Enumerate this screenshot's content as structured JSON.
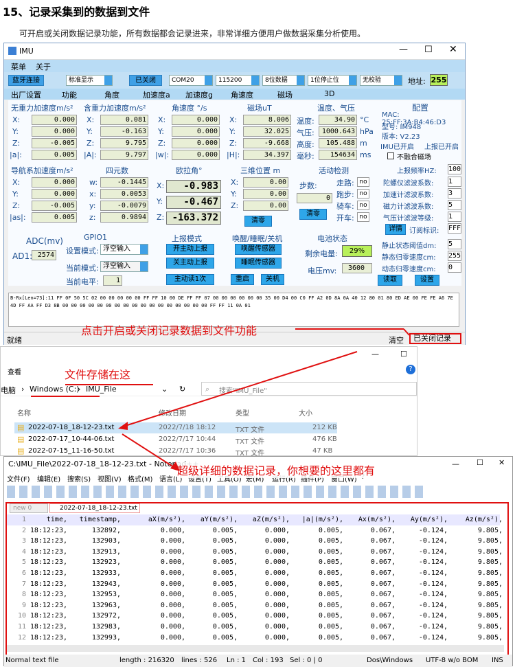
{
  "heading": "15、记录采集到的数据到文件",
  "intro": "可开启或关闭数据记录功能，所有数据都会记录进来，非常详细方便用户做数据采集分析使用。",
  "imu": {
    "title": "IMU",
    "menu": [
      "菜单",
      "关于"
    ],
    "toolbar": {
      "bt": "蓝牙连接",
      "display": "标准显示",
      "closed": "已关闭",
      "port": "COM20",
      "baud": "115200",
      "bits": "8位数据",
      "stop": "1位停止位",
      "parity": "无校验",
      "addr_label": "地址:",
      "addr": "255"
    },
    "tabs": [
      "出厂设置",
      "功能",
      "角度",
      "加速度a",
      "加速度g",
      "角速度",
      "磁场",
      "3D"
    ],
    "acc_nog": {
      "title": "无重力加速度m/s²",
      "labels": [
        "X:",
        "Y:",
        "Z:",
        "|a|:"
      ],
      "values": [
        "0.000",
        "0.000",
        "-0.005",
        "0.005"
      ]
    },
    "acc_g": {
      "title": "含重力加速度m/s²",
      "labels": [
        "X:",
        "Y:",
        "Z:",
        "|A|:"
      ],
      "values": [
        "0.081",
        "-0.163",
        "9.795",
        "9.797"
      ]
    },
    "gyro": {
      "title": "角速度 °/s",
      "labels": [
        "X:",
        "Y:",
        "Z:",
        "|w|:"
      ],
      "values": [
        "0.000",
        "0.000",
        "0.000",
        "0.000"
      ]
    },
    "mag": {
      "title": "磁场uT",
      "labels": [
        "X:",
        "Y:",
        "Z:",
        "|H|:"
      ],
      "values": [
        "8.006",
        "32.025",
        "-9.668",
        "34.397"
      ]
    },
    "env": {
      "title": "温度、气压",
      "labels": [
        "温度:",
        "气压:",
        "高度:",
        "毫秒:"
      ],
      "values": [
        "34.90",
        "1000.643",
        "105.488",
        "154634"
      ],
      "units": [
        "°C",
        "hPa",
        "m",
        "ms"
      ]
    },
    "config": {
      "title": "配置",
      "mac": "MAC: 25:FF:3A:B4:46:D3",
      "model": "型号: IM948",
      "version": "版本: V2.23",
      "state1": "IMU已开启",
      "state2": "上报已开启",
      "nomag": "不融合磁场",
      "items": [
        [
          "上报频率HZ:",
          "100"
        ],
        [
          "陀螺仪滤波系数:",
          "1"
        ],
        [
          "加速计滤波系数:",
          "3"
        ],
        [
          "磁力计滤波系数:",
          "5"
        ],
        [
          "气压计滤波等级:",
          "1"
        ]
      ],
      "detail": "详情",
      "sub": "订阅标识:",
      "sub_val": "FFF",
      "items2": [
        [
          "静止状态阈值dm:",
          "5"
        ],
        [
          "静态归零速度cm:",
          "255"
        ],
        [
          "动态归零速度cm:",
          "0"
        ]
      ],
      "read": "读取",
      "set": "设置"
    },
    "nav": {
      "title": "导航系加速度m/s²",
      "labels": [
        "X:",
        "Y:",
        "Z:",
        "|as|:"
      ],
      "values": [
        "0.000",
        "0.000",
        "-0.005",
        "0.005"
      ]
    },
    "quat": {
      "title": "四元数",
      "labels": [
        "w:",
        "x:",
        "y:",
        "z:"
      ],
      "values": [
        "-0.1445",
        "0.0053",
        "-0.0079",
        "0.9894"
      ]
    },
    "euler": {
      "title": "欧拉角°",
      "labels": [
        "X:",
        "Y:",
        "Z:"
      ],
      "values": [
        "-0.983",
        "-0.467",
        "-163.372"
      ]
    },
    "pos": {
      "title": "三维位置 m",
      "labels": [
        "X:",
        "Y:",
        "Z:"
      ],
      "values": [
        "0.00",
        "0.00",
        "0.00"
      ],
      "clear": "清零"
    },
    "activity": {
      "title": "活动检测",
      "steps": "步数:",
      "steps_val": "0",
      "clear": "清零",
      "items": [
        [
          "走路:",
          "no"
        ],
        [
          "跑步:",
          "no"
        ],
        [
          "骑车:",
          "no"
        ],
        [
          "开车:",
          "no"
        ]
      ]
    },
    "adc": {
      "title": "ADC(mv)",
      "label": "AD1:",
      "value": "2574"
    },
    "gpio": {
      "title": "GPIO1",
      "mode_label": "设置模式:",
      "mode": "浮空输入",
      "cur_label": "当前模式:",
      "cur": "浮空输入",
      "level_label": "当前电平:",
      "level": "1"
    },
    "report": {
      "title": "上报模式",
      "b1": "开主动上报",
      "b2": "关主动上报",
      "b3": "主动读1次"
    },
    "wake": {
      "title": "唤醒/睡眠/关机",
      "b1": "唤醒传感器",
      "b2": "睡眠传感器",
      "b3": "重启",
      "b4": "关机"
    },
    "battery": {
      "title": "电池状态",
      "rem_label": "剩余电量:",
      "rem": "29%",
      "v_label": "电压mv:",
      "v": "3600"
    },
    "raw": "B-Rx[Len=73]:11 FF 0F 50 5C 02 00 00 00 00 00 FF FF 10 00 DE FF FF 07 00 00 00 00 00 00 35 00 D4 00 C0 FF A2 0D 8A 0A 40 12 80 01 80 ED AE 00 FE FE A6 7E 4D FF AA FF D3 8B 00 00 00 00 00 00 00 00 00 00 00 00 00 00 00 00 00 FF FF 11 0A 01",
    "status_left": "就绪",
    "clear": "清空",
    "log": "已关闭记录"
  },
  "callouts": {
    "c1": "点击开启或关闭记录数据到文件功能",
    "c2": "文件存储在这",
    "c3": "超级详细的数据记录，你想要的这里都有"
  },
  "explorer": {
    "view": "查看",
    "path": [
      "电脑",
      "Windows (C:)",
      "IMU_File"
    ],
    "search": "搜索\"IMU_File\"",
    "headers": [
      "名称",
      "修改日期",
      "类型",
      "大小"
    ],
    "files": [
      [
        "2022-07-18_18-12-23.txt",
        "2022/7/18 18:12",
        "TXT 文件",
        "212 KB"
      ],
      [
        "2022-07-17_10-44-06.txt",
        "2022/7/17 10:44",
        "TXT 文件",
        "476 KB"
      ],
      [
        "2022-07-15_11-16-50.txt",
        "2022/7/17 10:36",
        "TXT 文件",
        "47 KB"
      ]
    ]
  },
  "npp": {
    "title": "C:\\IMU_File\\2022-07-18_18-12-23.txt - Notepad++",
    "menu": [
      "文件(F)",
      "编辑(E)",
      "搜索(S)",
      "视图(V)",
      "格式(M)",
      "语言(L)",
      "设置(T)",
      "工具(O)",
      "宏(M)",
      "运行(R)",
      "插件(P)",
      "窗口(W)",
      "?"
    ],
    "tab1": "new 0",
    "tab2": "2022-07-18_18-12-23.txt",
    "header": [
      "time,",
      "timestamp,",
      "aX(m/s²),",
      "aY(m/s²),",
      "aZ(m/s²),",
      "|a|(m/s²),",
      "Ax(m/s²),",
      "Ay(m/s²),",
      "Az(m/s²),"
    ],
    "rows": [
      [
        "18:12:23,",
        "132892,",
        "0.000,",
        "0.005,",
        "0.000,",
        "0.005,",
        "0.067,",
        "-0.124,",
        "9.805,"
      ],
      [
        "18:12:23,",
        "132903,",
        "0.000,",
        "0.005,",
        "0.000,",
        "0.005,",
        "0.067,",
        "-0.124,",
        "9.805,"
      ],
      [
        "18:12:23,",
        "132913,",
        "0.000,",
        "0.005,",
        "0.000,",
        "0.005,",
        "0.067,",
        "-0.124,",
        "9.805,"
      ],
      [
        "18:12:23,",
        "132923,",
        "0.000,",
        "0.005,",
        "0.000,",
        "0.005,",
        "0.067,",
        "-0.124,",
        "9.805,"
      ],
      [
        "18:12:23,",
        "132933,",
        "0.000,",
        "0.005,",
        "0.000,",
        "0.005,",
        "0.067,",
        "-0.124,",
        "9.805,"
      ],
      [
        "18:12:23,",
        "132943,",
        "0.000,",
        "0.005,",
        "0.000,",
        "0.005,",
        "0.067,",
        "-0.124,",
        "9.805,"
      ],
      [
        "18:12:23,",
        "132953,",
        "0.000,",
        "0.005,",
        "0.000,",
        "0.005,",
        "0.067,",
        "-0.124,",
        "9.805,"
      ],
      [
        "18:12:23,",
        "132963,",
        "0.000,",
        "0.005,",
        "0.000,",
        "0.005,",
        "0.067,",
        "-0.124,",
        "9.805,"
      ],
      [
        "18:12:23,",
        "132972,",
        "0.000,",
        "0.005,",
        "0.000,",
        "0.005,",
        "0.067,",
        "-0.124,",
        "9.805,"
      ],
      [
        "18:12:23,",
        "132983,",
        "0.000,",
        "0.005,",
        "0.000,",
        "0.005,",
        "0.067,",
        "-0.124,",
        "9.805,"
      ],
      [
        "18:12:23,",
        "132993,",
        "0.000,",
        "0.005,",
        "0.000,",
        "0.005,",
        "0.067,",
        "-0.124,",
        "9.805,"
      ]
    ],
    "status": [
      "Normal text file",
      "length : 216320",
      "lines : 526",
      "Ln : 1",
      "Col : 193",
      "Sel : 0 | 0",
      "Dos\\Windows",
      "UTF-8 w/o BOM",
      "INS"
    ]
  }
}
